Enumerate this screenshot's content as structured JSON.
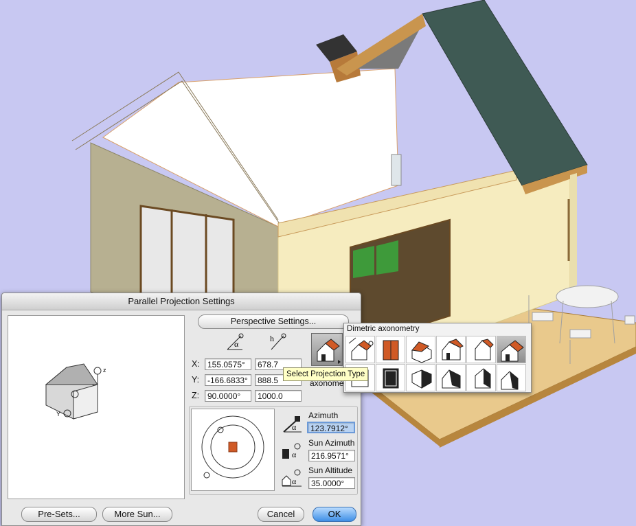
{
  "dialog": {
    "title": "Parallel Projection Settings",
    "perspective_button": "Perspective Settings...",
    "coords": {
      "x_label": "X:",
      "y_label": "Y:",
      "z_label": "Z:",
      "x_angle": "155.0575°",
      "y_angle": "-166.6833°",
      "z_angle": "90.0000°",
      "x_value": "678.7",
      "y_value": "888.5",
      "z_value": "1000.0"
    },
    "projection_label": "axonome",
    "preview_axis_label": "z",
    "preview_y_label": "Y",
    "sun": {
      "azimuth_label": "Azimuth",
      "azimuth_value": "123.7912°",
      "sun_azimuth_label": "Sun Azimuth",
      "sun_azimuth_value": "216.9571°",
      "sun_altitude_label": "Sun Altitude",
      "sun_altitude_value": "35.0000°"
    },
    "buttons": {
      "presets": "Pre-Sets...",
      "more_sun": "More Sun...",
      "cancel": "Cancel",
      "ok": "OK"
    }
  },
  "palette": {
    "title": "Dimetric axonometry",
    "tooltip": "Select Projection Type"
  },
  "icons": {
    "alpha_glyph": "α",
    "h_glyph": "h"
  },
  "colors": {
    "roof": "#3f5a54",
    "wall": "#f4ebc2",
    "deck": "#e6c486",
    "accent": "#d05a26"
  }
}
